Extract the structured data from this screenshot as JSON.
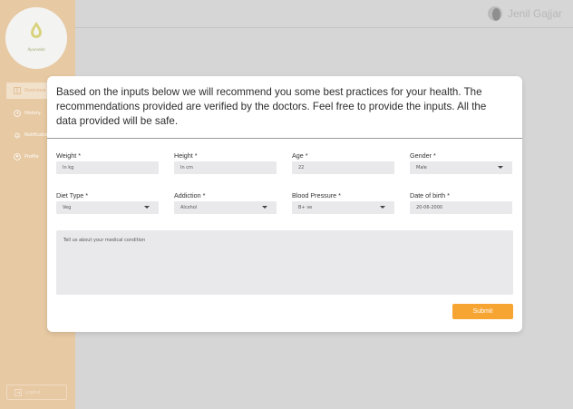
{
  "sidebar": {
    "logo_text": "Ayurveda",
    "items": [
      {
        "label": "Overview",
        "icon": "dashboard-icon",
        "active": true
      },
      {
        "label": "History",
        "icon": "clock-icon",
        "active": false
      },
      {
        "label": "Notifications",
        "icon": "bell-icon",
        "active": false
      },
      {
        "label": "Profile",
        "icon": "user-icon",
        "active": false
      }
    ],
    "logout_label": "Logout"
  },
  "header": {
    "user_name": "Jenil Gajjar"
  },
  "modal": {
    "description": "Based on the inputs below we will recommend you some best practices for your health. The recommendations provided are verified by the doctors. Feel free to provide the inputs. All the data provided will be safe.",
    "fields": {
      "weight": {
        "label": "Weight *",
        "placeholder": "In kg"
      },
      "height": {
        "label": "Height *",
        "placeholder": "In cm"
      },
      "age": {
        "label": "Age *",
        "value": "22"
      },
      "gender": {
        "label": "Gender *",
        "value": "Male"
      },
      "diet_type": {
        "label": "Diet Type *",
        "value": "Veg"
      },
      "addiction": {
        "label": "Addiction *",
        "value": "Alcohol"
      },
      "blood_pressure": {
        "label": "Blood Pressure *",
        "value": "B+ ve"
      },
      "dob": {
        "label": "Date of birth *",
        "value": "20-06-2000"
      }
    },
    "medical_placeholder": "Tell us about your medical condition",
    "submit_label": "Submit"
  },
  "colors": {
    "sidebar_bg": "#e7c9a3",
    "accent": "#f7a532",
    "overlay_bg": "#d6d6d6"
  }
}
